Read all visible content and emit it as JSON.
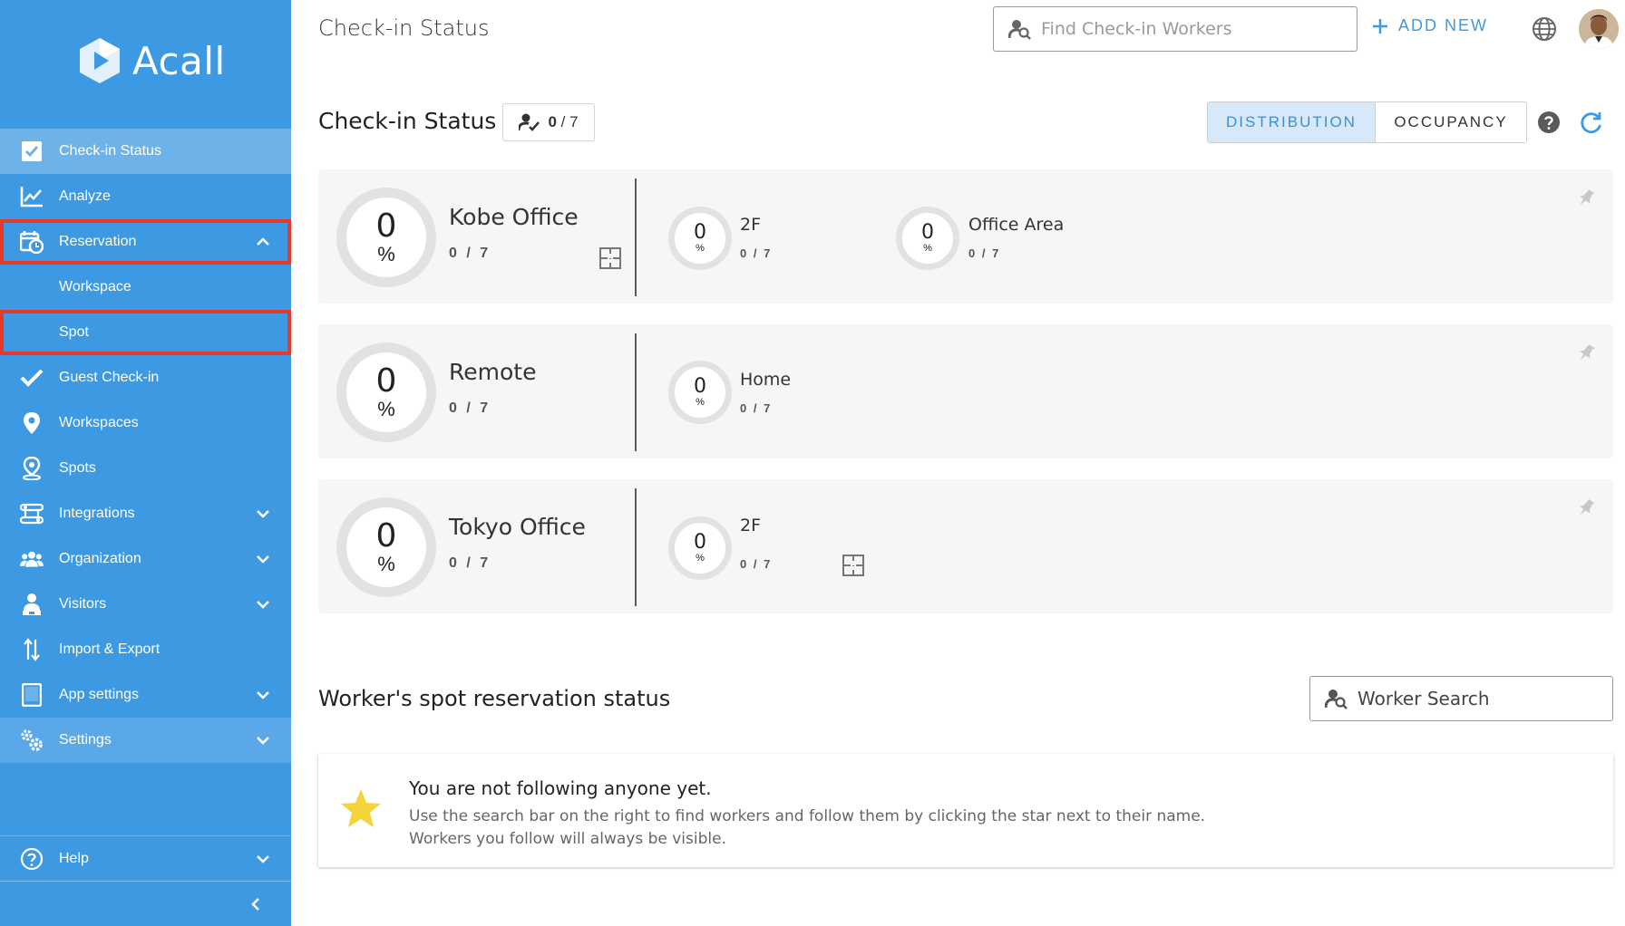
{
  "app": {
    "name": "Acall"
  },
  "header": {
    "title": "Check-in Status",
    "search_placeholder": "Find Check-in Workers",
    "add_new_label": "ADD NEW"
  },
  "sidebar": {
    "items": [
      {
        "label": "Check-in Status",
        "icon": "checkbox-icon"
      },
      {
        "label": "Analyze",
        "icon": "line-chart-icon"
      },
      {
        "label": "Reservation",
        "icon": "calendar-clock-icon"
      },
      {
        "label": "Workspace"
      },
      {
        "label": "Spot"
      },
      {
        "label": "Guest Check-in",
        "icon": "check-icon"
      },
      {
        "label": "Workspaces",
        "icon": "map-pin-icon"
      },
      {
        "label": "Spots",
        "icon": "spot-pin-icon"
      },
      {
        "label": "Integrations",
        "icon": "integrations-icon"
      },
      {
        "label": "Organization",
        "icon": "people-icon"
      },
      {
        "label": "Visitors",
        "icon": "visitor-icon"
      },
      {
        "label": "Import & Export",
        "icon": "import-export-icon"
      },
      {
        "label": "App settings",
        "icon": "tablet-icon"
      },
      {
        "label": "Settings",
        "icon": "gears-icon"
      }
    ],
    "help_label": "Help"
  },
  "status": {
    "title": "Check-in Status",
    "count": "0",
    "total": "/ 7",
    "tabs": [
      "DISTRIBUTION",
      "OCCUPANCY"
    ],
    "active_tab": "DISTRIBUTION"
  },
  "locations": [
    {
      "name": "Kobe Office",
      "percent": "0",
      "count": "0 / 7",
      "areas": [
        {
          "name": "2F",
          "percent": "0",
          "count": "0 / 7"
        },
        {
          "name": "Office Area",
          "percent": "0",
          "count": "0 / 7"
        }
      ]
    },
    {
      "name": "Remote",
      "percent": "0",
      "count": "0 / 7",
      "areas": [
        {
          "name": "Home",
          "percent": "0",
          "count": "0 / 7"
        }
      ]
    },
    {
      "name": "Tokyo Office",
      "percent": "0",
      "count": "0 / 7",
      "areas": [
        {
          "name": "2F",
          "percent": "0",
          "count": "0 / 7"
        }
      ]
    }
  ],
  "pct_symbol": "%",
  "workers": {
    "title": "Worker's spot reservation status",
    "search_placeholder": "Worker Search",
    "empty_title": "You are not following anyone yet.",
    "empty_line1": "Use the search bar on the right to find workers and follow them by clicking the star next to their name.",
    "empty_line2": "Workers you follow will always be visible."
  },
  "colors": {
    "sidebar": "#3d9ae2",
    "sidebar_active": "#6db2e9",
    "highlight": "#e23b2c",
    "accent": "#3d9ae2",
    "star": "#f5d33a"
  }
}
